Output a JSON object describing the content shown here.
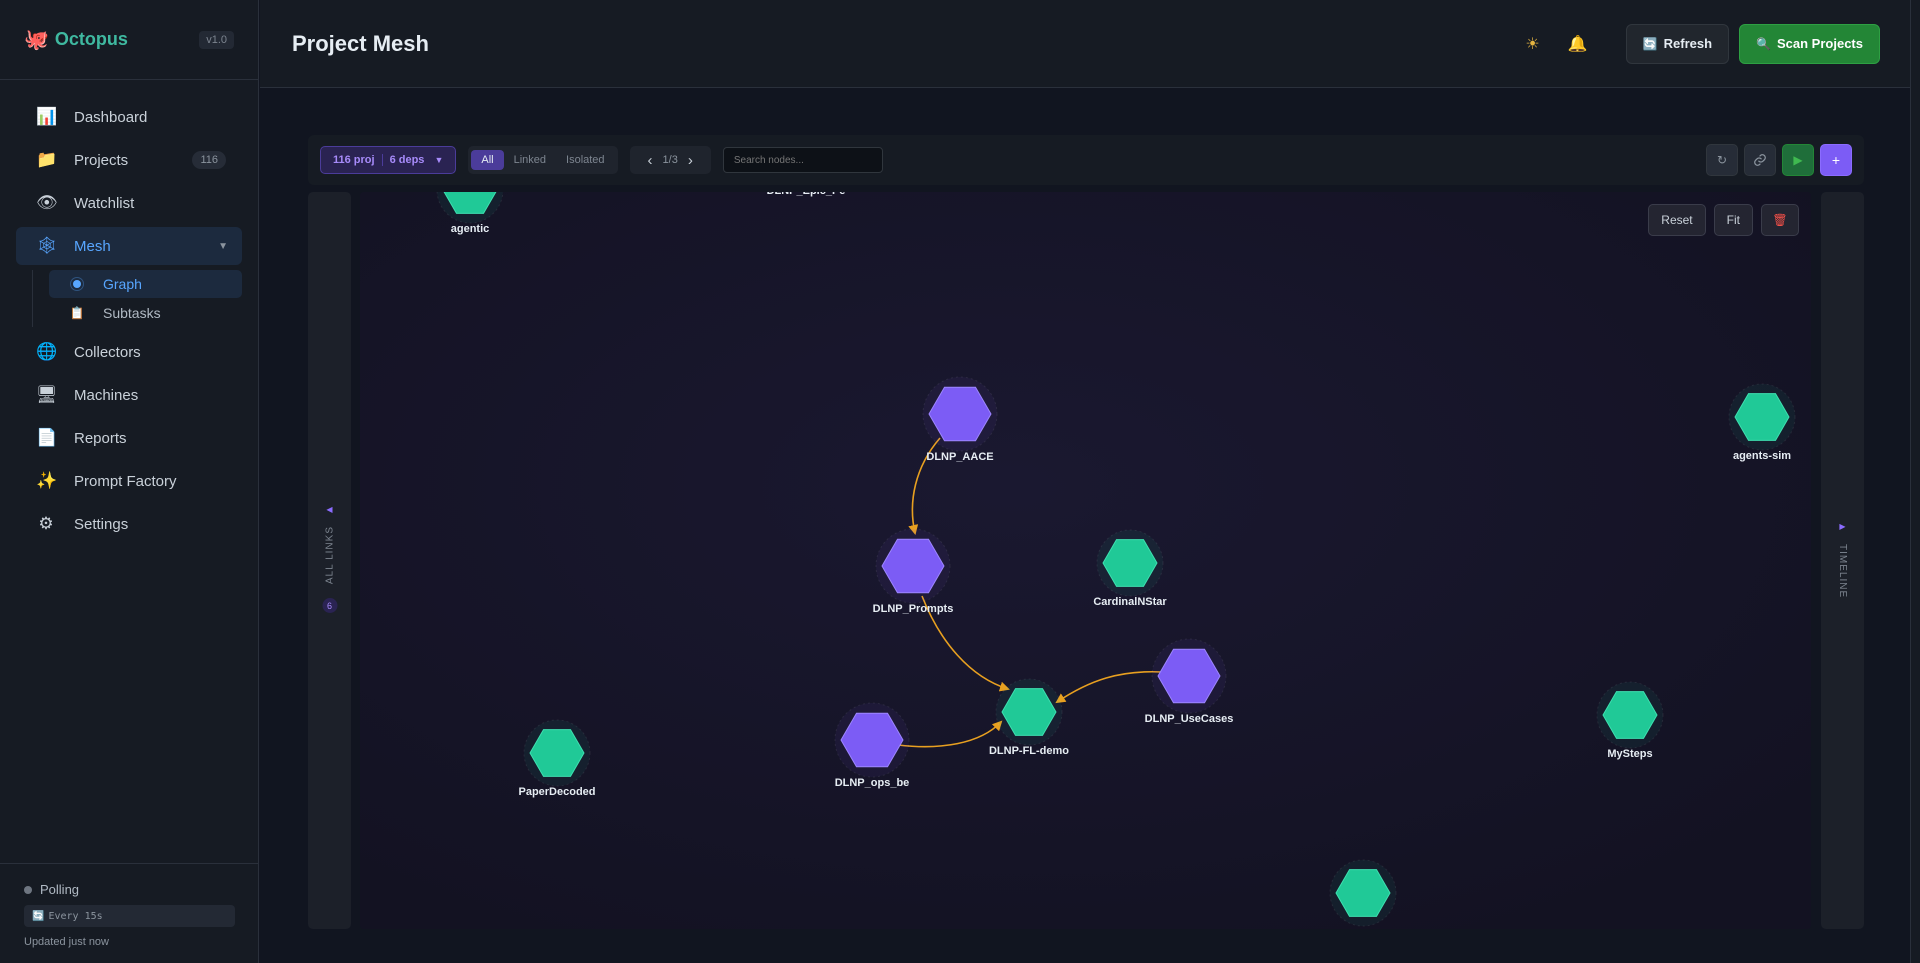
{
  "app": {
    "logo": "🐙",
    "name": "Octopus",
    "version": "v1.0"
  },
  "nav": [
    {
      "icon": "📊",
      "label": "Dashboard"
    },
    {
      "icon": "📁",
      "label": "Projects",
      "count": "116"
    },
    {
      "icon": "👁",
      "label": "Watchlist"
    },
    {
      "icon": "🕸",
      "label": "Mesh",
      "active": true
    }
  ],
  "mesh_sub": [
    {
      "label": "Graph",
      "active": true
    },
    {
      "icon": "📋",
      "label": "Subtasks"
    }
  ],
  "nav2": [
    {
      "icon": "🌐",
      "label": "Collectors"
    },
    {
      "icon": "🖥",
      "label": "Machines"
    },
    {
      "icon": "📄",
      "label": "Reports"
    },
    {
      "icon": "✨",
      "label": "Prompt Factory"
    },
    {
      "icon": "⚙",
      "label": "Settings"
    }
  ],
  "footer": {
    "polling": "Polling",
    "every": "Every 15s",
    "updated": "Updated just now"
  },
  "header": {
    "title": "Project Mesh",
    "refresh_label": "Refresh",
    "scan_label": "Scan Projects",
    "theme_icon": "☀",
    "bell_icon": "🔔"
  },
  "toolbar": {
    "proj": "116 proj",
    "deps": "6 deps",
    "filters": [
      "All",
      "Linked",
      "Isolated"
    ],
    "active_filter": "All",
    "page": "1/3",
    "search_placeholder": "Search nodes..."
  },
  "canvas_controls": {
    "reset": "Reset",
    "fit": "Fit"
  },
  "rails": {
    "left_label": "ALL LINKS",
    "left_count": "6",
    "right_label": "TIMELINE"
  },
  "colors": {
    "linked": "#7c5cf5",
    "isolated": "#20c997",
    "edge": "#e8a020"
  },
  "graph": {
    "nodes": [
      {
        "id": "agentic",
        "label": "agentic",
        "kind": "isolated"
      },
      {
        "id": "DLNP_AACE",
        "label": "DLNP_AACE",
        "kind": "linked"
      },
      {
        "id": "DLNP_Prompts",
        "label": "DLNP_Prompts",
        "kind": "linked"
      },
      {
        "id": "CardinalNStar",
        "label": "CardinalNStar",
        "kind": "isolated"
      },
      {
        "id": "DLNP_UseCases",
        "label": "DLNP_UseCases",
        "kind": "linked"
      },
      {
        "id": "DLNP-FL-demo",
        "label": "DLNP-FL-demo",
        "kind": "isolated"
      },
      {
        "id": "DLNP_ops_be",
        "label": "DLNP_ops_be",
        "kind": "linked"
      },
      {
        "id": "PaperDecoded",
        "label": "PaperDecoded",
        "kind": "isolated"
      },
      {
        "id": "agents-sim",
        "label": "agents-sim",
        "kind": "isolated"
      },
      {
        "id": "MySteps",
        "label": "MySteps",
        "kind": "isolated"
      },
      {
        "id": "unlabeled-bottom",
        "label": "",
        "kind": "isolated"
      }
    ],
    "edges": [
      {
        "from": "DLNP_AACE",
        "to": "DLNP_Prompts"
      },
      {
        "from": "DLNP_Prompts",
        "to": "DLNP-FL-demo"
      },
      {
        "from": "DLNP_UseCases",
        "to": "DLNP-FL-demo"
      },
      {
        "from": "DLNP_ops_be",
        "to": "DLNP-FL-demo"
      }
    ]
  }
}
